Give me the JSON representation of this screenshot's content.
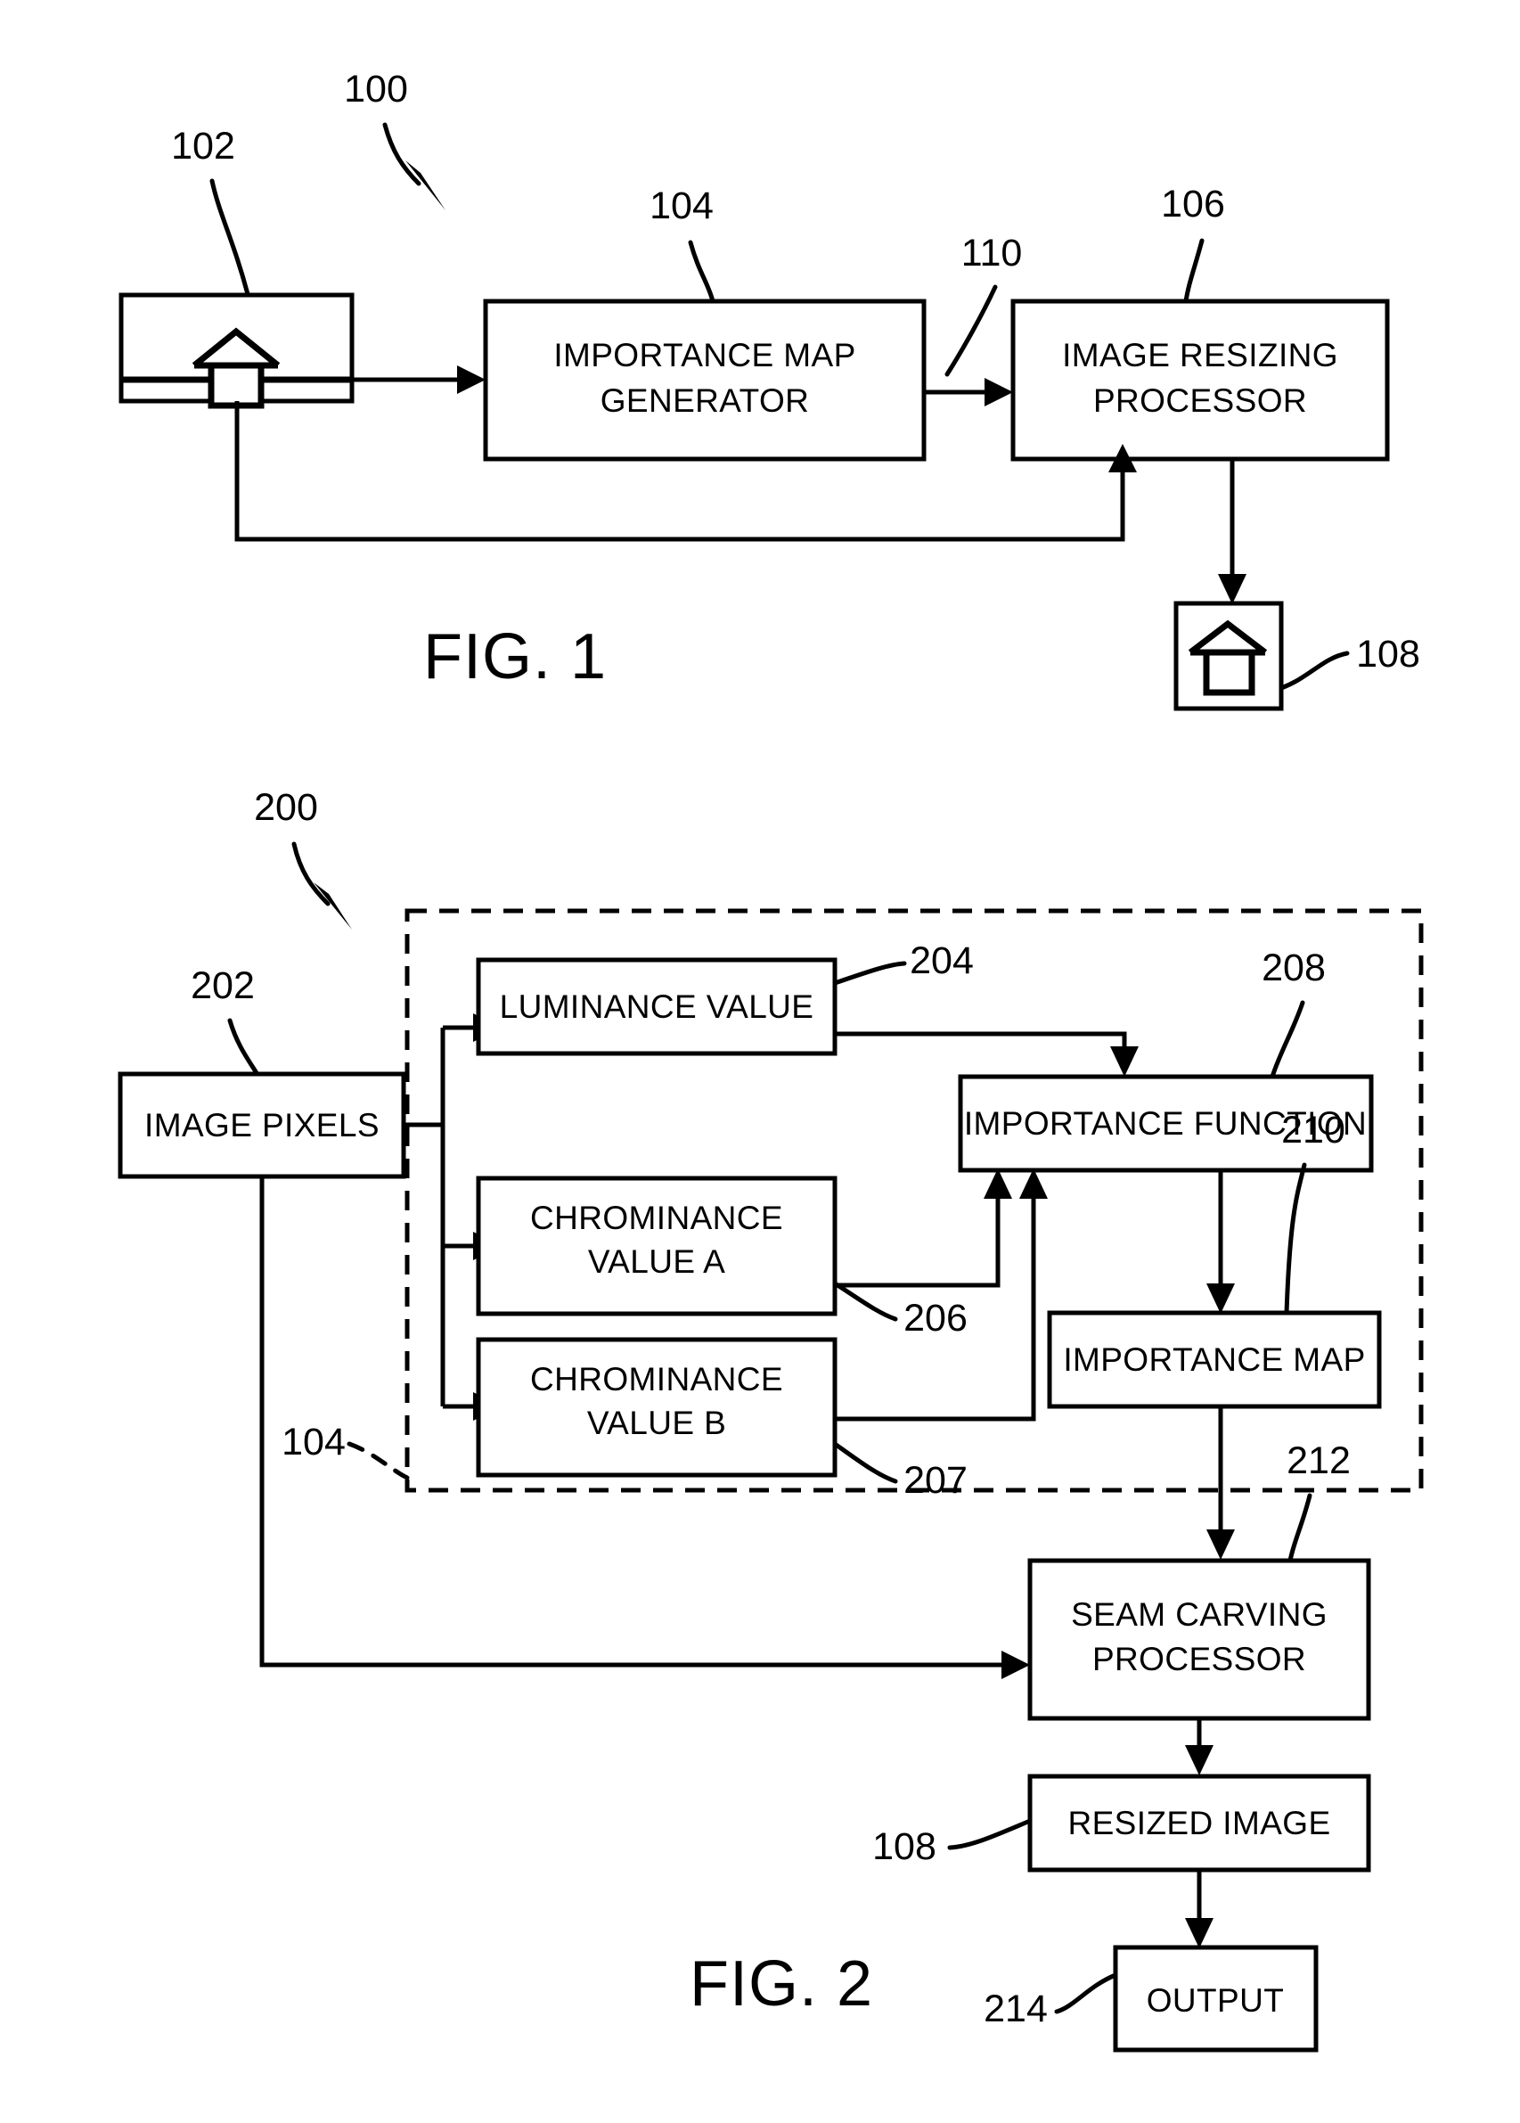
{
  "document": {
    "type": "patent-drawing",
    "sheet_background": "#ffffff",
    "ink_color": "#000000"
  },
  "figures": [
    {
      "id": "fig1",
      "title": "FIG. 1",
      "system_ref": "100",
      "nodes": [
        {
          "ref": "102",
          "label": "",
          "kind": "image-thumbnail",
          "icon": "house-image-icon"
        },
        {
          "ref": "104",
          "label_line1": "IMPORTANCE MAP",
          "label_line2": "GENERATOR",
          "kind": "process-box"
        },
        {
          "ref": "106",
          "label_line1": "IMAGE RESIZING",
          "label_line2": "PROCESSOR",
          "kind": "process-box"
        },
        {
          "ref": "108",
          "label": "",
          "kind": "resized-image-thumbnail",
          "icon": "house-image-icon"
        }
      ],
      "edge_refs": [
        "110"
      ]
    },
    {
      "id": "fig2",
      "title": "FIG. 2",
      "system_ref": "200",
      "group_ref": "104",
      "nodes": [
        {
          "ref": "202",
          "label": "IMAGE PIXELS",
          "kind": "data-box"
        },
        {
          "ref": "204",
          "label": "LUMINANCE VALUE",
          "kind": "data-box"
        },
        {
          "ref": "206",
          "label_line1": "CHROMINANCE",
          "label_line2": "VALUE A",
          "kind": "data-box"
        },
        {
          "ref": "207",
          "label_line1": "CHROMINANCE",
          "label_line2": "VALUE B",
          "kind": "data-box"
        },
        {
          "ref": "208",
          "label": "IMPORTANCE FUNCTION",
          "kind": "process-box"
        },
        {
          "ref": "210",
          "label": "IMPORTANCE MAP",
          "kind": "data-box"
        },
        {
          "ref": "212",
          "label_line1": "SEAM CARVING",
          "label_line2": "PROCESSOR",
          "kind": "process-box"
        },
        {
          "ref": "108",
          "label": "RESIZED IMAGE",
          "kind": "data-box"
        },
        {
          "ref": "214",
          "label": "OUTPUT",
          "kind": "terminal-box"
        }
      ]
    }
  ],
  "fig1": {
    "title": "FIG. 1",
    "ref_100": "100",
    "ref_102": "102",
    "ref_104": "104",
    "ref_106": "106",
    "ref_108": "108",
    "ref_110": "110",
    "box104_line1": "IMPORTANCE MAP",
    "box104_line2": "GENERATOR",
    "box106_line1": "IMAGE RESIZING",
    "box106_line2": "PROCESSOR"
  },
  "fig2": {
    "title": "FIG. 2",
    "ref_200": "200",
    "ref_202": "202",
    "ref_204": "204",
    "ref_206": "206",
    "ref_207": "207",
    "ref_208": "208",
    "ref_210": "210",
    "ref_212": "212",
    "ref_108": "108",
    "ref_214": "214",
    "ref_104": "104",
    "box202_label": "IMAGE PIXELS",
    "box204_label": "LUMINANCE VALUE",
    "box206_line1": "CHROMINANCE",
    "box206_line2": "VALUE A",
    "box207_line1": "CHROMINANCE",
    "box207_line2": "VALUE B",
    "box208_label": "IMPORTANCE FUNCTION",
    "box210_label": "IMPORTANCE MAP",
    "box212_line1": "SEAM CARVING",
    "box212_line2": "PROCESSOR",
    "box108_label": "RESIZED IMAGE",
    "box214_label": "OUTPUT"
  }
}
